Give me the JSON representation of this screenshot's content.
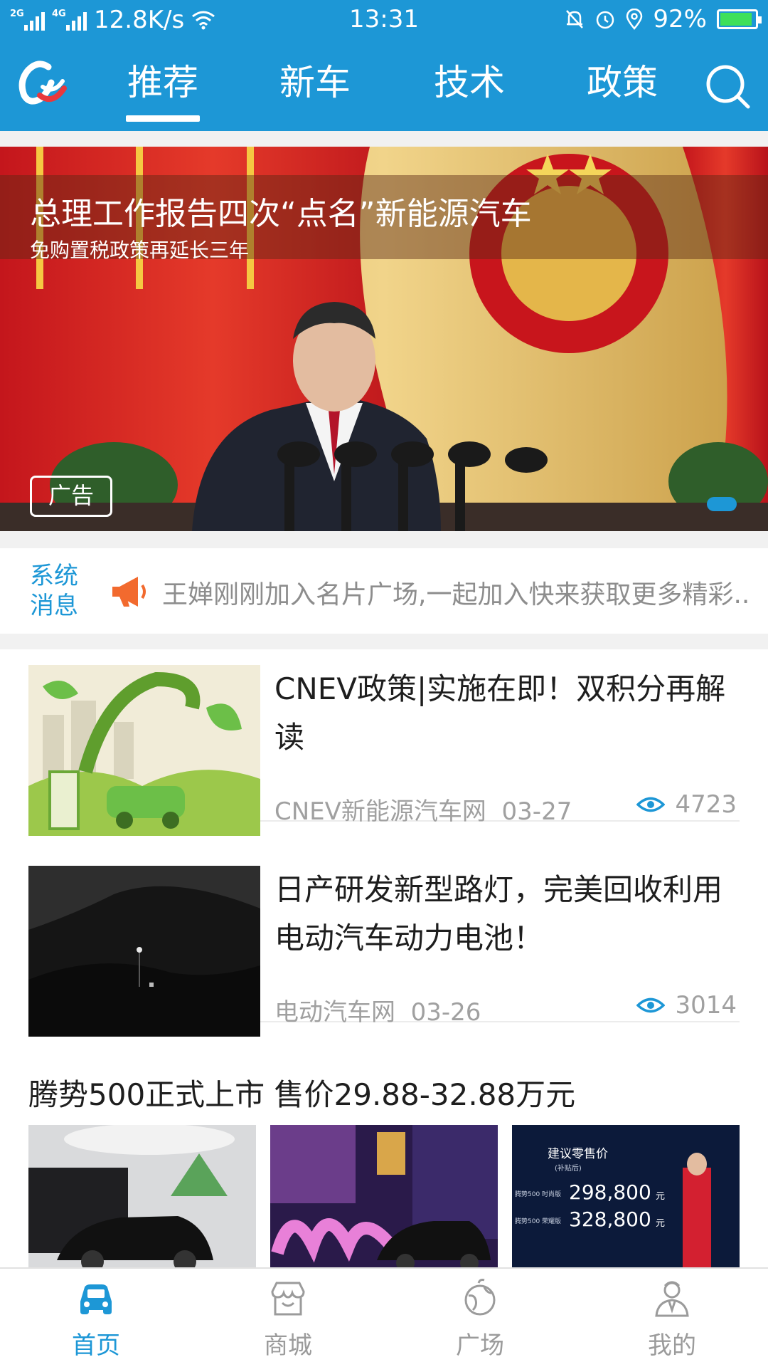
{
  "status_bar": {
    "sim1": "2G",
    "sim2": "4G",
    "speed": "12.8K/s",
    "time": "13:31",
    "battery": "92%",
    "battery_level": 0.92
  },
  "header": {
    "tabs": [
      {
        "label": "推荐",
        "active": true
      },
      {
        "label": "新车",
        "active": false
      },
      {
        "label": "技术",
        "active": false
      },
      {
        "label": "政策",
        "active": false
      }
    ]
  },
  "banner": {
    "title": "总理工作报告四次“点名”新能源汽车",
    "subtitle": "免购置税政策再延长三年",
    "ad_label": "广告"
  },
  "system_message": {
    "label": "系统消息",
    "text": "王婵刚刚加入名片广场,一起加入快来获取更多精彩..."
  },
  "news": [
    {
      "title": "CNEV政策|实施在即！双积分再解读",
      "source": "CNEV新能源汽车网",
      "date": "03-27",
      "views": "4723"
    },
    {
      "title": "日产研发新型路灯，完美回收利用电动汽车动力电池！",
      "source": "电动汽车网",
      "date": "03-26",
      "views": "3014"
    }
  ],
  "gallery": {
    "title": "腾势500正式上市 售价29.88-32.88万元",
    "price_caption": "建议零售价",
    "price_note": "(补贴后)",
    "prices": [
      {
        "label": "腾势500 时尚版",
        "value": "298,800",
        "unit": "元"
      },
      {
        "label": "腾势500 荣耀版",
        "value": "328,800",
        "unit": "元"
      }
    ]
  },
  "bottom_nav": [
    {
      "label": "首页",
      "icon": "car-icon",
      "active": true
    },
    {
      "label": "商城",
      "icon": "store-icon",
      "active": false
    },
    {
      "label": "广场",
      "icon": "globe-icon",
      "active": false
    },
    {
      "label": "我的",
      "icon": "user-icon",
      "active": false
    }
  ],
  "colors": {
    "brand": "#1d97d6",
    "horn": "#f26a2e",
    "muted_text": "#a0a0a0"
  }
}
